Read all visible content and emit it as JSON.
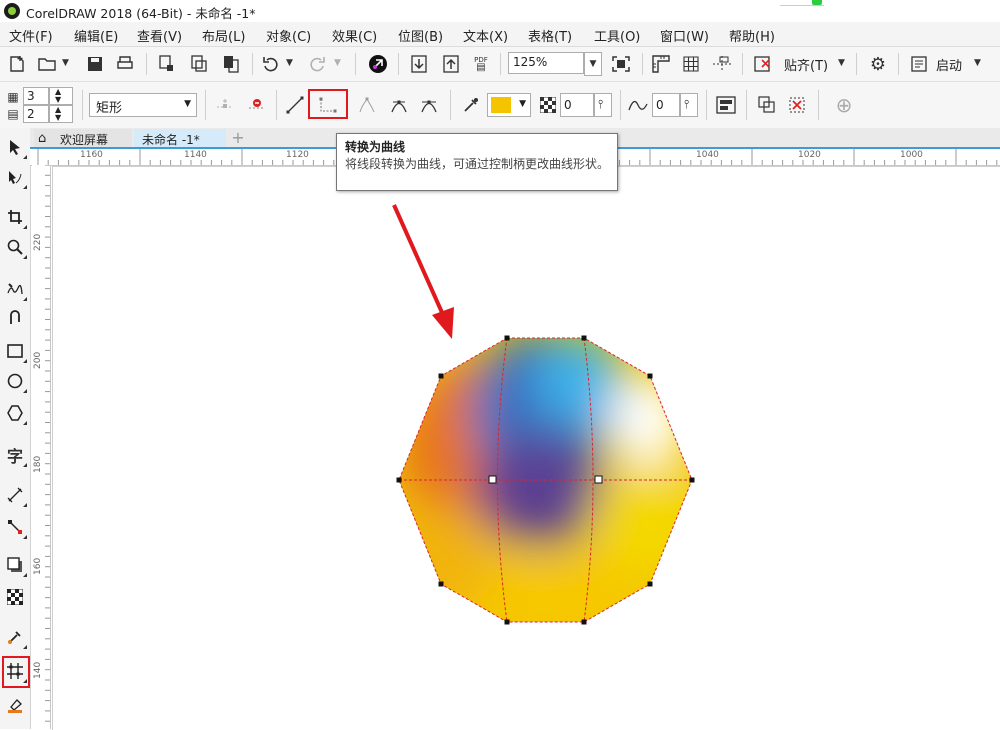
{
  "window": {
    "title": "CorelDRAW 2018 (64-Bit) - 未命名 -1*"
  },
  "menu": [
    "文件(F)",
    "编辑(E)",
    "查看(V)",
    "布局(L)",
    "对象(C)",
    "效果(C)",
    "位图(B)",
    "文本(X)",
    "表格(T)",
    "工具(O)",
    "窗口(W)",
    "帮助(H)"
  ],
  "toolbar1": {
    "pdf_label": "PDF",
    "zoom_value": "125%",
    "snap_label": "贴齐(T)",
    "launch_label": "启动"
  },
  "toolbar2": {
    "rows_value": "3",
    "cols_value": "2",
    "shape_type": "矩形",
    "transparency_value": "0",
    "smoothing_value": "0",
    "fill_color": "#f5c400"
  },
  "tabs": {
    "welcome": "欢迎屏幕",
    "document": "未命名 -1*",
    "add": "+"
  },
  "ruler_h": [
    "1160",
    "1140",
    "1120",
    "1040",
    "1020",
    "1000"
  ],
  "ruler_v": [
    "220",
    "200",
    "180",
    "160",
    "140"
  ],
  "tooltip": {
    "title": "转换为曲线",
    "description": "将线段转换为曲线，可通过控制柄更改曲线形状。"
  },
  "colors": {
    "highlight": "#e0191f",
    "accent": "#3d9bd6"
  }
}
